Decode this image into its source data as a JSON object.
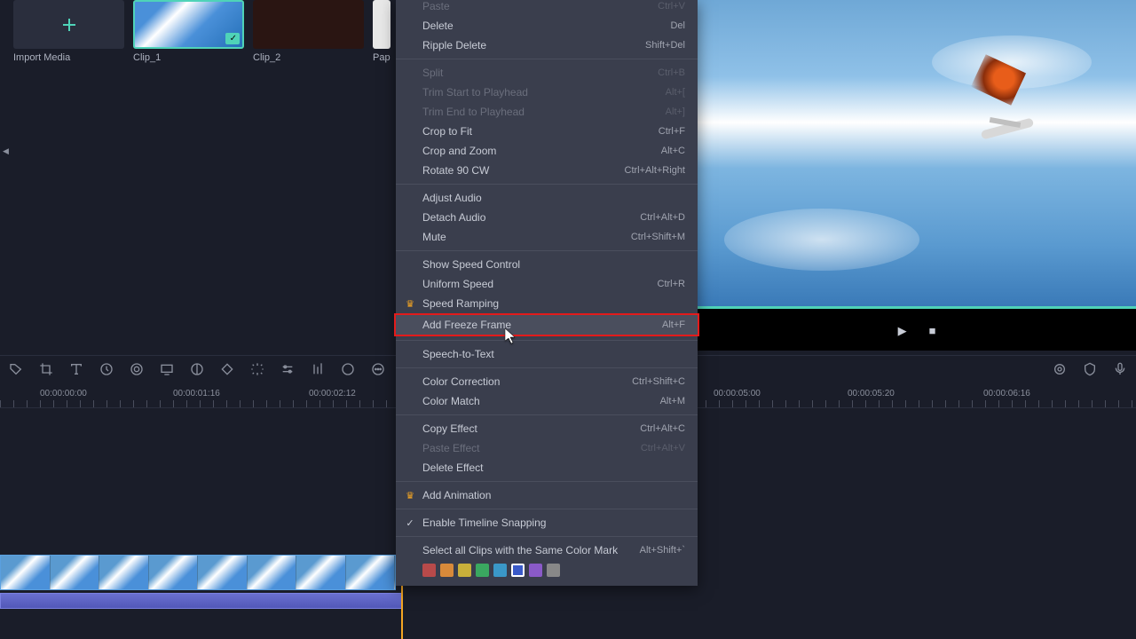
{
  "media": {
    "import_label": "Import Media",
    "clips": [
      {
        "label": "Clip_1"
      },
      {
        "label": "Clip_2"
      },
      {
        "label": "Pap"
      }
    ]
  },
  "context_menu": {
    "items": [
      {
        "label": "Paste",
        "shortcut": "Ctrl+V",
        "disabled": true,
        "topcut": true
      },
      {
        "label": "Delete",
        "shortcut": "Del"
      },
      {
        "label": "Ripple Delete",
        "shortcut": "Shift+Del"
      },
      {
        "divider": true
      },
      {
        "label": "Split",
        "shortcut": "Ctrl+B",
        "disabled": true
      },
      {
        "label": "Trim Start to Playhead",
        "shortcut": "Alt+[",
        "disabled": true
      },
      {
        "label": "Trim End to Playhead",
        "shortcut": "Alt+]",
        "disabled": true
      },
      {
        "label": "Crop to Fit",
        "shortcut": "Ctrl+F"
      },
      {
        "label": "Crop and Zoom",
        "shortcut": "Alt+C"
      },
      {
        "label": "Rotate 90 CW",
        "shortcut": "Ctrl+Alt+Right"
      },
      {
        "divider": true
      },
      {
        "label": "Adjust Audio",
        "shortcut": ""
      },
      {
        "label": "Detach Audio",
        "shortcut": "Ctrl+Alt+D"
      },
      {
        "label": "Mute",
        "shortcut": "Ctrl+Shift+M"
      },
      {
        "divider": true
      },
      {
        "label": "Show Speed Control",
        "shortcut": ""
      },
      {
        "label": "Uniform Speed",
        "shortcut": "Ctrl+R"
      },
      {
        "label": "Speed Ramping",
        "shortcut": "",
        "crown": true
      },
      {
        "label": "Add Freeze Frame",
        "shortcut": "Alt+F",
        "highlighted": true
      },
      {
        "divider": true
      },
      {
        "label": "Speech-to-Text",
        "shortcut": ""
      },
      {
        "divider": true
      },
      {
        "label": "Color Correction",
        "shortcut": "Ctrl+Shift+C"
      },
      {
        "label": "Color Match",
        "shortcut": "Alt+M"
      },
      {
        "divider": true
      },
      {
        "label": "Copy Effect",
        "shortcut": "Ctrl+Alt+C"
      },
      {
        "label": "Paste Effect",
        "shortcut": "Ctrl+Alt+V",
        "disabled": true
      },
      {
        "label": "Delete Effect",
        "shortcut": ""
      },
      {
        "divider": true
      },
      {
        "label": "Add Animation",
        "shortcut": "",
        "crown": true
      },
      {
        "divider": true
      },
      {
        "label": "Enable Timeline Snapping",
        "shortcut": "",
        "check": true
      },
      {
        "divider": true
      },
      {
        "label": "Select all Clips with the Same Color Mark",
        "shortcut": "Alt+Shift+`"
      }
    ],
    "color_marks": [
      "#b84a4a",
      "#d88a3a",
      "#c8b03a",
      "#3aa860",
      "#3a98c8",
      "#3a5ac8",
      "#8a5ac8",
      "#888888"
    ],
    "selected_color_index": 5
  },
  "timeline": {
    "marks": [
      {
        "label": "00:00:00:00",
        "pos": 45
      },
      {
        "label": "00:00:01:16",
        "pos": 195
      },
      {
        "label": "00:00:02:12",
        "pos": 348
      },
      {
        "label": "00:00:05:00",
        "pos": 804
      },
      {
        "label": "00:00:05:20",
        "pos": 955
      },
      {
        "label": "00:00:06:16",
        "pos": 1108
      }
    ]
  }
}
